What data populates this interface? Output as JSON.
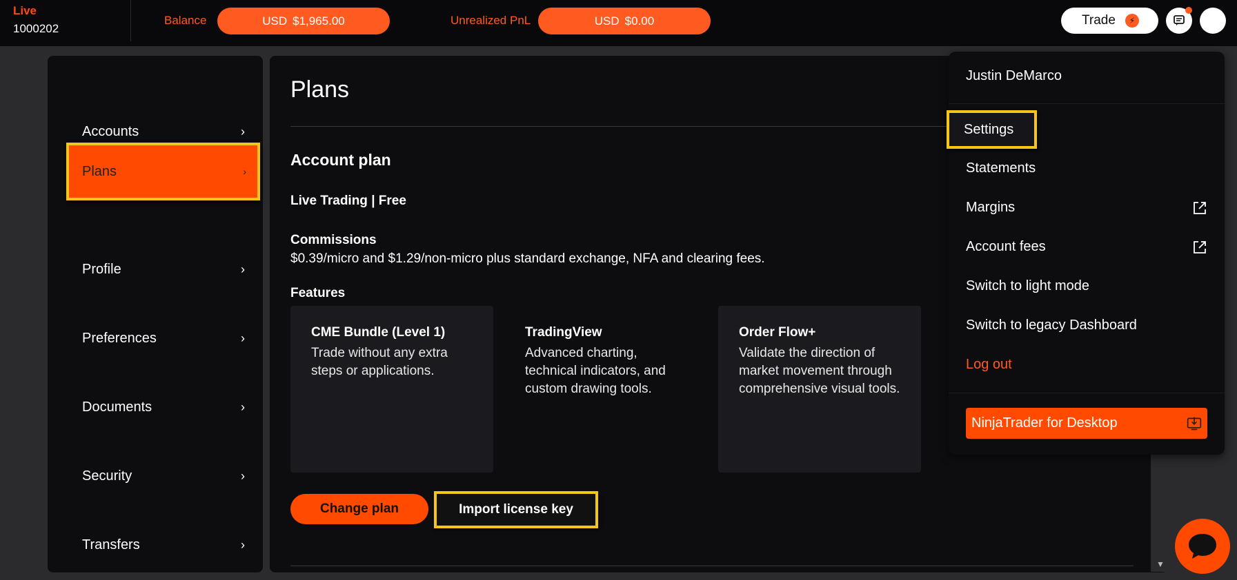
{
  "topbar": {
    "mode": "Live",
    "account_number": "1000202",
    "balance_label": "Balance",
    "balance_currency": "USD",
    "balance_value": "$1,965.00",
    "pnl_label": "Unrealized PnL",
    "pnl_currency": "USD",
    "pnl_value": "$0.00",
    "trade_label": "Trade"
  },
  "sidebar": {
    "items": [
      {
        "label": "Accounts"
      },
      {
        "label": "Plans"
      },
      {
        "label": "Profile"
      },
      {
        "label": "Preferences"
      },
      {
        "label": "Documents"
      },
      {
        "label": "Security"
      },
      {
        "label": "Transfers"
      }
    ],
    "chevron": "›"
  },
  "main": {
    "title": "Plans",
    "section_title": "Account plan",
    "plan_line": "Live Trading | Free",
    "commissions_title": "Commissions",
    "commissions_text": "$0.39/micro and $1.29/non-micro plus standard exchange, NFA and clearing fees.",
    "features_title": "Features",
    "features": [
      {
        "title": "CME Bundle (Level 1)",
        "text": "Trade without any extra steps or applications."
      },
      {
        "title": "TradingView",
        "text": "Advanced charting, technical indicators, and custom drawing tools."
      },
      {
        "title": "Order Flow+",
        "text": "Validate the direction of market movement through comprehensive visual tools."
      }
    ],
    "change_plan_label": "Change plan",
    "import_key_label": "Import license key"
  },
  "dropdown": {
    "user_name": "Justin DeMarco",
    "settings": "Settings",
    "statements": "Statements",
    "margins": "Margins",
    "account_fees": "Account fees",
    "light_mode": "Switch to light mode",
    "legacy_dashboard": "Switch to legacy Dashboard",
    "logout": "Log out",
    "ninjatrader_desktop": "NinjaTrader for Desktop"
  },
  "colors": {
    "accent": "#ff4a00",
    "highlight": "#f5c518",
    "background": "#0d0d10"
  }
}
